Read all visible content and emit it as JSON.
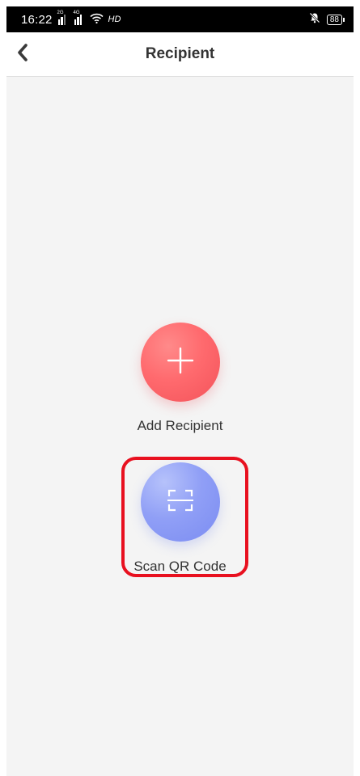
{
  "status_bar": {
    "time": "16:22",
    "sim1_tag": "2G",
    "sim2_tag": "4G",
    "network": "HD",
    "battery": "88"
  },
  "header": {
    "title": "Recipient"
  },
  "actions": {
    "add_label": "Add Recipient",
    "scan_label": "Scan QR Code"
  },
  "icons": {
    "back": "chevron-left-icon",
    "add": "plus-icon",
    "scan": "qr-scan-icon",
    "wifi": "wifi-icon",
    "mute": "bell-off-icon"
  },
  "colors": {
    "add_button": "#ff6a6e",
    "scan_button": "#909ff6",
    "highlight": "#e8101f",
    "background": "#f4f4f4"
  }
}
